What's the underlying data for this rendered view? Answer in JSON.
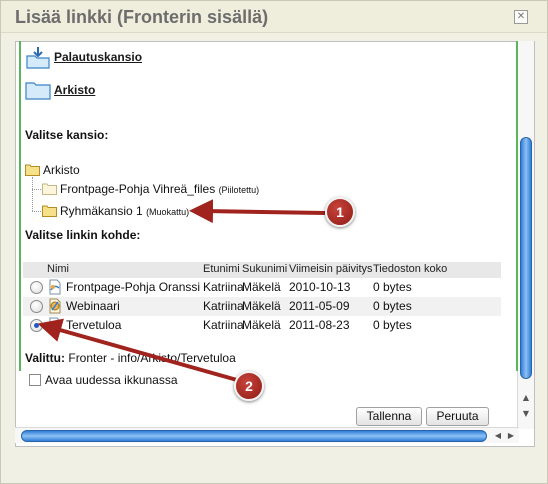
{
  "dialog": {
    "title": "Lisää linkki (Fronterin sisällä)",
    "close_symbol": "✕"
  },
  "top_folders": [
    {
      "label": "Palautuskansio",
      "icon": "dropbox-folder-icon"
    },
    {
      "label": "Arkisto",
      "icon": "folder-icon"
    }
  ],
  "folder_section": {
    "heading": "Valitse kansio:",
    "root": "Arkisto",
    "children": [
      {
        "label": "Frontpage-Pohja Vihreä_files",
        "note": "(Piilotettu)"
      },
      {
        "label": "Ryhmäkansio 1",
        "note": "(Muokattu)"
      }
    ]
  },
  "target_section": {
    "heading": "Valitse linkin kohde:",
    "columns": {
      "name": "Nimi",
      "firstname": "Etunimi",
      "lastname": "Sukunimi",
      "updated": "Viimeisin päivitys",
      "size": "Tiedoston koko"
    },
    "rows": [
      {
        "name": "Frontpage-Pohja Oranssi",
        "firstname": "Katriina",
        "lastname": "Mäkelä",
        "updated": "2010-10-13",
        "size": "0 bytes",
        "selected": false
      },
      {
        "name": "Webinaari",
        "firstname": "Katriina",
        "lastname": "Mäkelä",
        "updated": "2011-05-09",
        "size": "0 bytes",
        "selected": false
      },
      {
        "name": "Tervetuloa",
        "firstname": "Katriina",
        "lastname": "Mäkelä",
        "updated": "2011-08-23",
        "size": "0 bytes",
        "selected": true
      }
    ]
  },
  "selection": {
    "label": "Valittu:",
    "value": "Fronter - info/Arkisto/Tervetuloa"
  },
  "open_new_window": {
    "label": "Avaa uudessa ikkunassa",
    "checked": false
  },
  "buttons": {
    "save": "Tallenna",
    "cancel": "Peruuta"
  },
  "callouts": [
    "1",
    "2"
  ],
  "colors": {
    "accent_green": "#5bb55b",
    "scroll_blue": "#2f7fd8",
    "callout_red": "#9e2520"
  }
}
